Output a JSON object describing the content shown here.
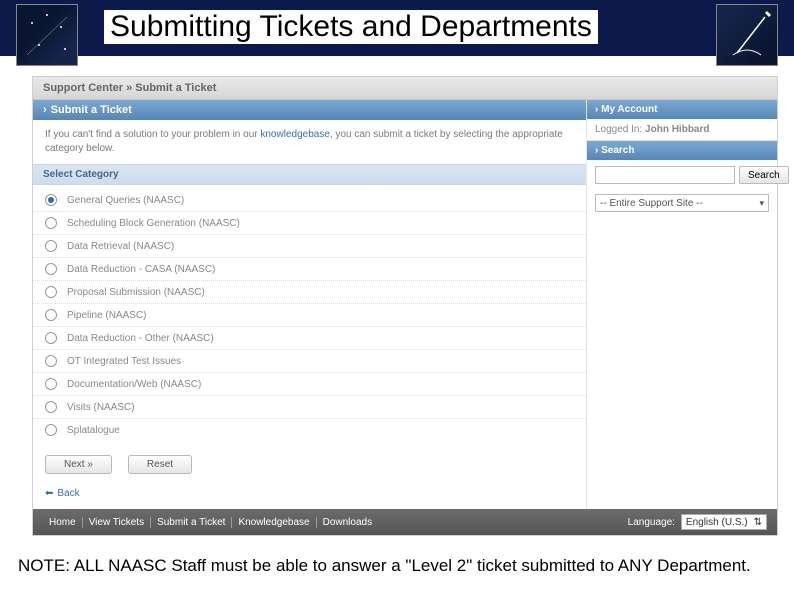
{
  "slide": {
    "title": "Submitting Tickets and Departments",
    "note": "NOTE: ALL NAASC Staff must be able to answer a \"Level 2\" ticket submitted to ANY Department."
  },
  "breadcrumb": "Support Center » Submit a Ticket",
  "main": {
    "header": "Submit a Ticket",
    "intro_pre": "If you can't find a solution to your problem in our ",
    "intro_kb": "knowledgebase",
    "intro_post": ", you can submit a ticket by selecting the appropriate category below.",
    "section_label": "Select Category",
    "categories": [
      "General Queries (NAASC)",
      "Scheduling Block Generation (NAASC)",
      "Data Retrieval (NAASC)",
      "Data Reduction - CASA (NAASC)",
      "Proposal Submission (NAASC)",
      "Pipeline (NAASC)",
      "Data Reduction - Other (NAASC)",
      "OT Integrated Test Issues",
      "Documentation/Web (NAASC)",
      "Visits (NAASC)",
      "Splatalogue"
    ],
    "selected_index": 0,
    "next_label": "Next »",
    "reset_label": "Reset",
    "back_label": "Back"
  },
  "sidebar": {
    "my_account_header": "My Account",
    "logged_in_label": "Logged In: ",
    "user_name": "John Hibbard",
    "search_header": "Search",
    "search_placeholder": "",
    "search_button": "Search",
    "scope_selected": "-- Entire Support Site --"
  },
  "footer": {
    "links": [
      "Home",
      "View Tickets",
      "Submit a Ticket",
      "Knowledgebase",
      "Downloads"
    ],
    "language_label": "Language:",
    "language_selected": "English (U.S.)"
  }
}
